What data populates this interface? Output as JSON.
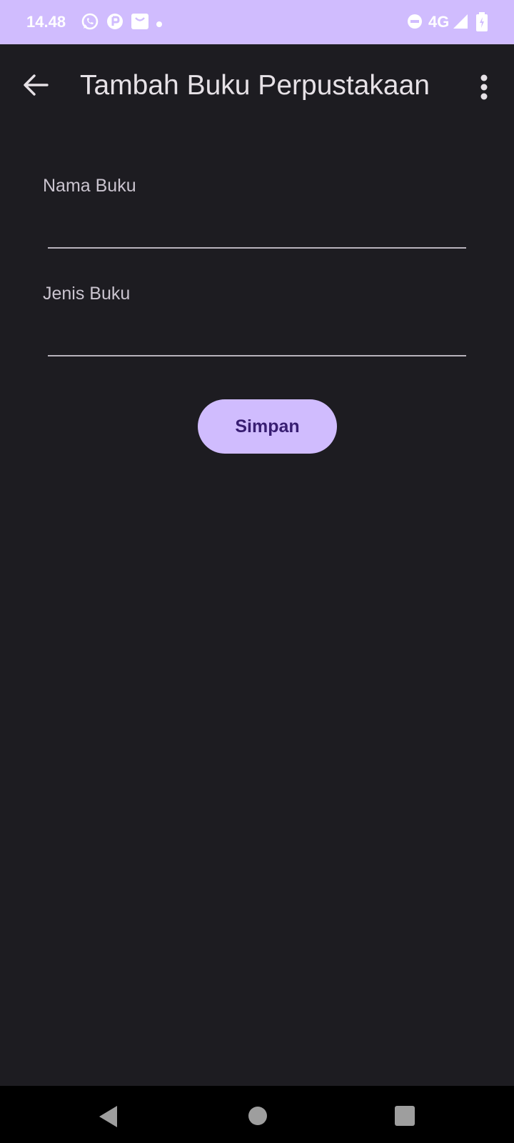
{
  "status_bar": {
    "time": "14.48",
    "network": "4G",
    "background_color": "#d0bcfe",
    "icons": [
      "whatsapp-icon",
      "app-notification-icon",
      "mail-icon",
      "dot-icon",
      "do-not-disturb-icon",
      "signal-icon",
      "battery-charging-icon"
    ]
  },
  "app_bar": {
    "title": "Tambah Buku Perpustakaan",
    "back_icon": "arrow-left-icon",
    "menu_icon": "more-vert-icon"
  },
  "form": {
    "nama_label": "Nama Buku",
    "nama_value": "",
    "jenis_label": "Jenis Buku",
    "jenis_value": "",
    "save_label": "Simpan"
  },
  "colors": {
    "background": "#1d1c21",
    "accent": "#d0bcfe",
    "button_text": "#381e72"
  },
  "nav_bar": {
    "icons": [
      "back-triangle-icon",
      "home-circle-icon",
      "recents-square-icon"
    ]
  }
}
